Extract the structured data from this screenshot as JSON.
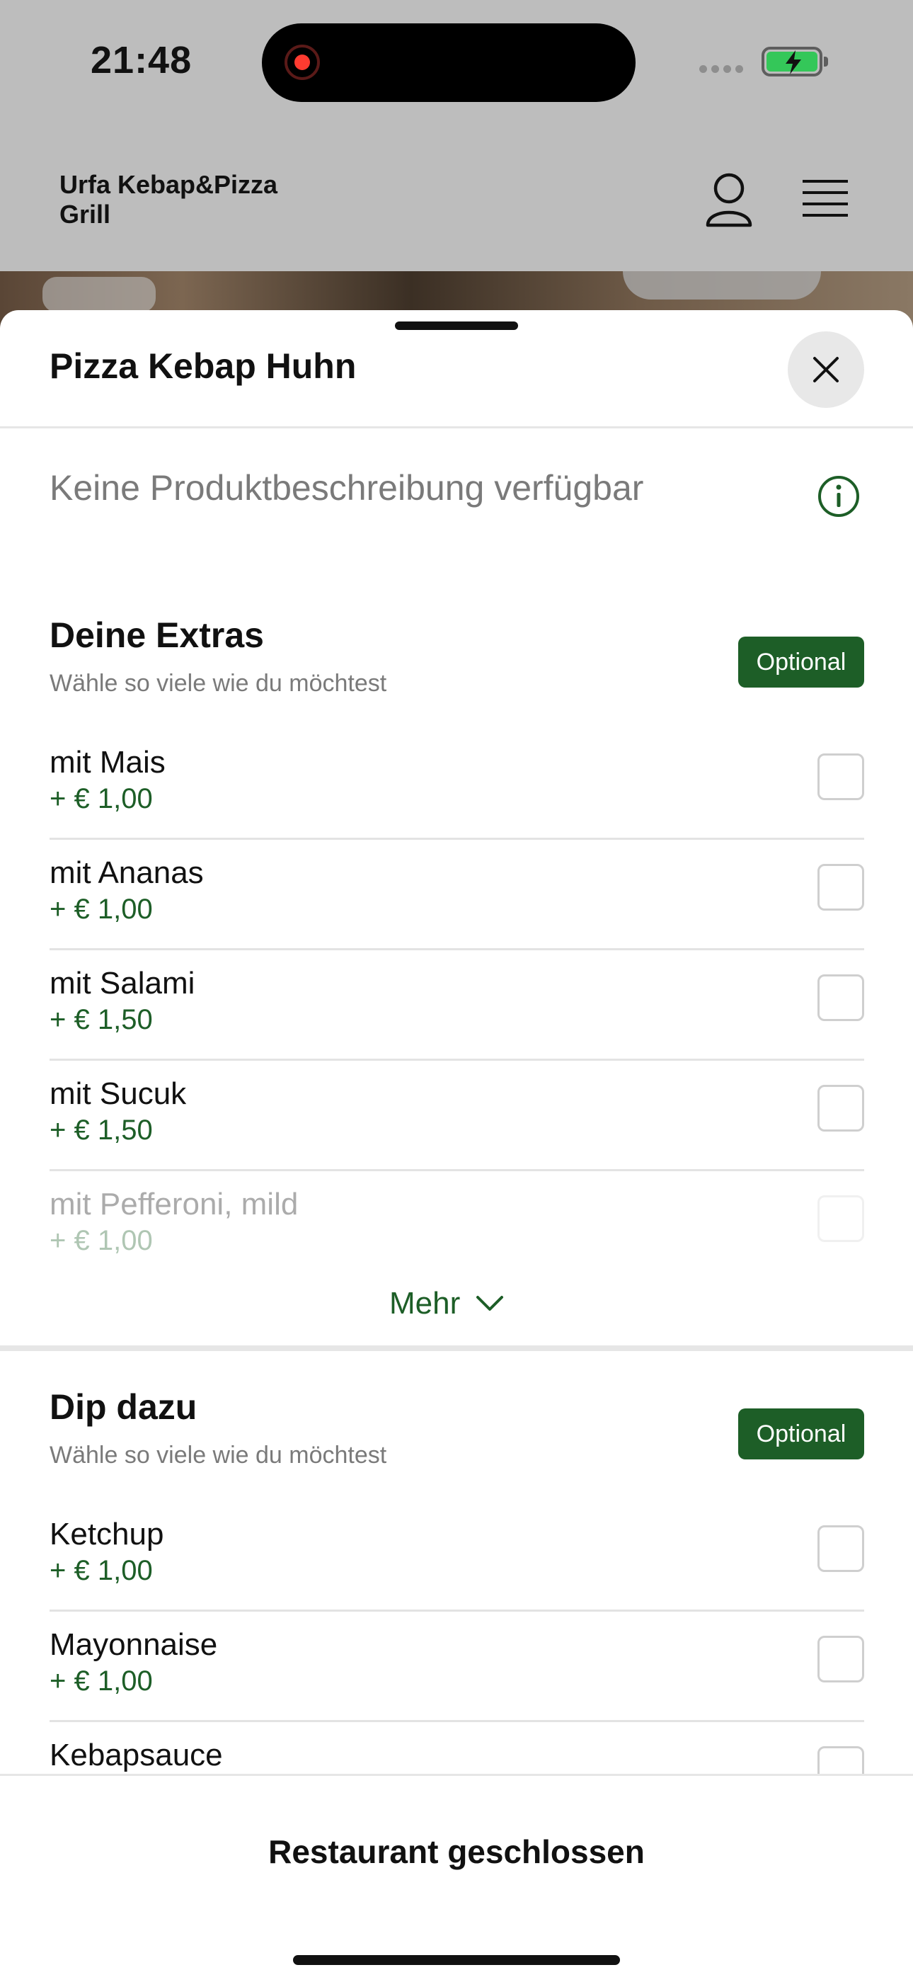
{
  "status_bar": {
    "time": "21:48"
  },
  "header": {
    "brand": "Urfa Kebap&Pizza Grill",
    "profile_icon": "person-icon",
    "menu_icon": "hamburger-icon"
  },
  "product": {
    "title": "Pizza Kebap Huhn",
    "description": "Keine Produktbeschreibung verfügbar"
  },
  "groups": [
    {
      "title": "Deine Extras",
      "subtitle": "Wähle so viele wie du möchtest",
      "badge": "Optional",
      "items": [
        {
          "name": "mit Mais",
          "price": "+ € 1,00"
        },
        {
          "name": "mit Ananas",
          "price": "+ € 1,00"
        },
        {
          "name": "mit Salami",
          "price": "+ € 1,50"
        },
        {
          "name": "mit Sucuk",
          "price": "+ € 1,50"
        },
        {
          "name": "mit Pefferoni, mild",
          "price": "+ € 1,00"
        }
      ],
      "more_label": "Mehr"
    },
    {
      "title": "Dip dazu",
      "subtitle": "Wähle so viele wie du möchtest",
      "badge": "Optional",
      "items": [
        {
          "name": "Ketchup",
          "price": "+ € 1,00"
        },
        {
          "name": "Mayonnaise",
          "price": "+ € 1,00"
        },
        {
          "name": "Kebapsauce",
          "price": ""
        }
      ]
    }
  ],
  "footer": {
    "label": "Restaurant geschlossen"
  },
  "colors": {
    "accent": "#1d5e27",
    "overlay": "#bdbdbd",
    "badge_text": "#ffffff"
  }
}
